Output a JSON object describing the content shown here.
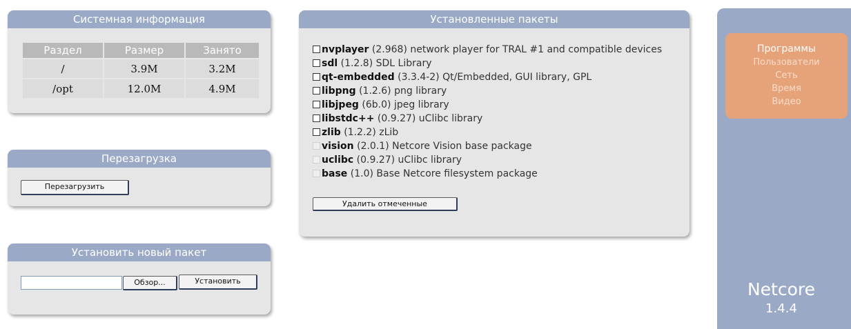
{
  "system_info": {
    "title": "Системная информация",
    "columns": [
      "Раздел",
      "Размер",
      "Занято"
    ],
    "rows": [
      [
        "/",
        "3.9M",
        "3.2M"
      ],
      [
        "/opt",
        "12.0M",
        "4.9M"
      ]
    ]
  },
  "reboot": {
    "title": "Перезагрузка",
    "button_label": "Перезагрузить"
  },
  "install": {
    "title": "Установить новый пакет",
    "file_value": "",
    "browse_label": "Обзор...",
    "install_label": "Установить"
  },
  "packages": {
    "title": "Установленные пакеты",
    "items": [
      {
        "name": "nvplayer",
        "version": "(2.968)",
        "desc": "network player for TRAL #1 and compatible devices",
        "removable": true
      },
      {
        "name": "sdl",
        "version": "(1.2.8)",
        "desc": "SDL Library",
        "removable": true
      },
      {
        "name": "qt-embedded",
        "version": "(3.3.4-2)",
        "desc": "Qt/Embedded, GUI library, GPL",
        "removable": true
      },
      {
        "name": "libpng",
        "version": "(1.2.6)",
        "desc": "png library",
        "removable": true
      },
      {
        "name": "libjpeg",
        "version": "(6b.0)",
        "desc": "jpeg library",
        "removable": true
      },
      {
        "name": "libstdc++",
        "version": "(0.9.27)",
        "desc": "uClibc library",
        "removable": true
      },
      {
        "name": "zlib",
        "version": "(1.2.2)",
        "desc": "zLib",
        "removable": true
      },
      {
        "name": "vision",
        "version": "(2.0.1)",
        "desc": "Netcore Vision base package",
        "removable": false
      },
      {
        "name": "uclibc",
        "version": "(0.9.27)",
        "desc": "uClibc library",
        "removable": false
      },
      {
        "name": "base",
        "version": "(1.0)",
        "desc": "Base Netcore filesystem package",
        "removable": false
      }
    ],
    "delete_label": "Удалить отмеченные"
  },
  "sidebar": {
    "menu": [
      {
        "label": "Программы",
        "active": true
      },
      {
        "label": "Пользователи",
        "active": false
      },
      {
        "label": "Сеть",
        "active": false
      },
      {
        "label": "Время",
        "active": false
      },
      {
        "label": "Видео",
        "active": false
      }
    ],
    "brand_name": "Netcore",
    "brand_version": "1.4.4"
  },
  "colors": {
    "panel_header": "#9aaac6",
    "panel_body": "#e6e6e6",
    "menu_box": "#e6a278",
    "sidebar": "#9aaac6"
  }
}
